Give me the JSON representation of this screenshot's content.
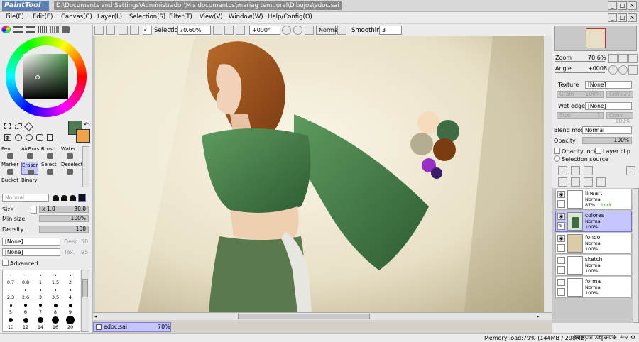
{
  "window": {
    "logo_text": "PaintTool SAI",
    "title": "D:\\Documents and Settings\\Administrador\\Mis documentos\\mariag temporal\\Dibujos\\edoc.sai"
  },
  "menu": [
    "File(F)",
    "Edit(E)",
    "Canvas(C)",
    "Layer(L)",
    "Selection(S)",
    "Filter(T)",
    "View(V)",
    "Window(W)",
    "Help/Config(O)"
  ],
  "toolbar": {
    "selection_label": "Selection",
    "zoom": "70.60%",
    "rotation": "+000°",
    "blend": "Normal",
    "smoothing_label": "Smoothing",
    "smoothing_value": "3"
  },
  "colors": {
    "primary": "#4f7b52",
    "secondary": "#f2a34a",
    "accent": "#c5c5ff"
  },
  "tools": {
    "row1": [
      "Pen",
      "AirBrush",
      "Brush",
      "Water"
    ],
    "row2": [
      "Marker",
      "Eraser",
      "Select",
      "Deselect"
    ],
    "row3": [
      "Bucket",
      "Binary"
    ],
    "selected": "Eraser"
  },
  "brush": {
    "mode": "Normal",
    "size_label": "Size",
    "size_mult": "x 1.0",
    "size_value": "30.0",
    "minsize_label": "Min size",
    "minsize_value": "100%",
    "density_label": "Density",
    "density_value": "100",
    "tex1": "[None]",
    "tex1_label": "Desc",
    "tex1_value": "50",
    "tex2": "[None]",
    "tex2_label": "Tex.",
    "tex2_value": "95",
    "advanced_label": "Advanced"
  },
  "brush_sizes": [
    [
      "0.7",
      "0.8",
      "1",
      "1.5",
      "2"
    ],
    [
      "2.3",
      "2.6",
      "3",
      "3.5",
      "4"
    ],
    [
      "5",
      "6",
      "7",
      "8",
      "9"
    ],
    [
      "10",
      "12",
      "14",
      "16",
      "20"
    ]
  ],
  "navigator": {
    "zoom_label": "Zoom",
    "zoom_value": "70.6%",
    "angle_label": "Angle",
    "angle_value": "+0008"
  },
  "texture": {
    "texture_label": "Texture",
    "texture_value": "[None]",
    "grain_label": "Grain",
    "grain_value": "100%",
    "conv_label": "Conv",
    "conv_value": "20",
    "wet_label": "Wet edge",
    "wet_value": "[None]",
    "size_label": "Size",
    "size_value": "1",
    "conv2_value": "100%"
  },
  "layer_props": {
    "blend_label": "Blend mode",
    "blend_value": "Normal",
    "opacity_label": "Opacity",
    "opacity_value": "100%",
    "opacity_lock": "Opacity lock",
    "layer_clip": "Layer clip",
    "selection_source": "Selection source"
  },
  "layers": [
    {
      "name": "lineart",
      "mode": "Normal",
      "opacity": "87%",
      "extra": "Lock",
      "visible": true,
      "selected": false
    },
    {
      "name": "colores",
      "mode": "Normal",
      "opacity": "100%",
      "extra": "",
      "visible": true,
      "selected": true
    },
    {
      "name": "fondo",
      "mode": "Normal",
      "opacity": "100%",
      "extra": "",
      "visible": true,
      "selected": false
    },
    {
      "name": "sketch",
      "mode": "Normal",
      "opacity": "100%",
      "extra": "",
      "visible": false,
      "selected": false
    },
    {
      "name": "forma",
      "mode": "Normal",
      "opacity": "100%",
      "extra": "",
      "visible": false,
      "selected": false
    }
  ],
  "doc_tab": {
    "name": "edoc.sai",
    "zoom": "70%"
  },
  "status": {
    "memory": "Memory load:79% (144MB / 298MB)",
    "keys": [
      "Shift",
      "Ctrl",
      "Alt",
      "SPC"
    ],
    "any": "Any"
  }
}
